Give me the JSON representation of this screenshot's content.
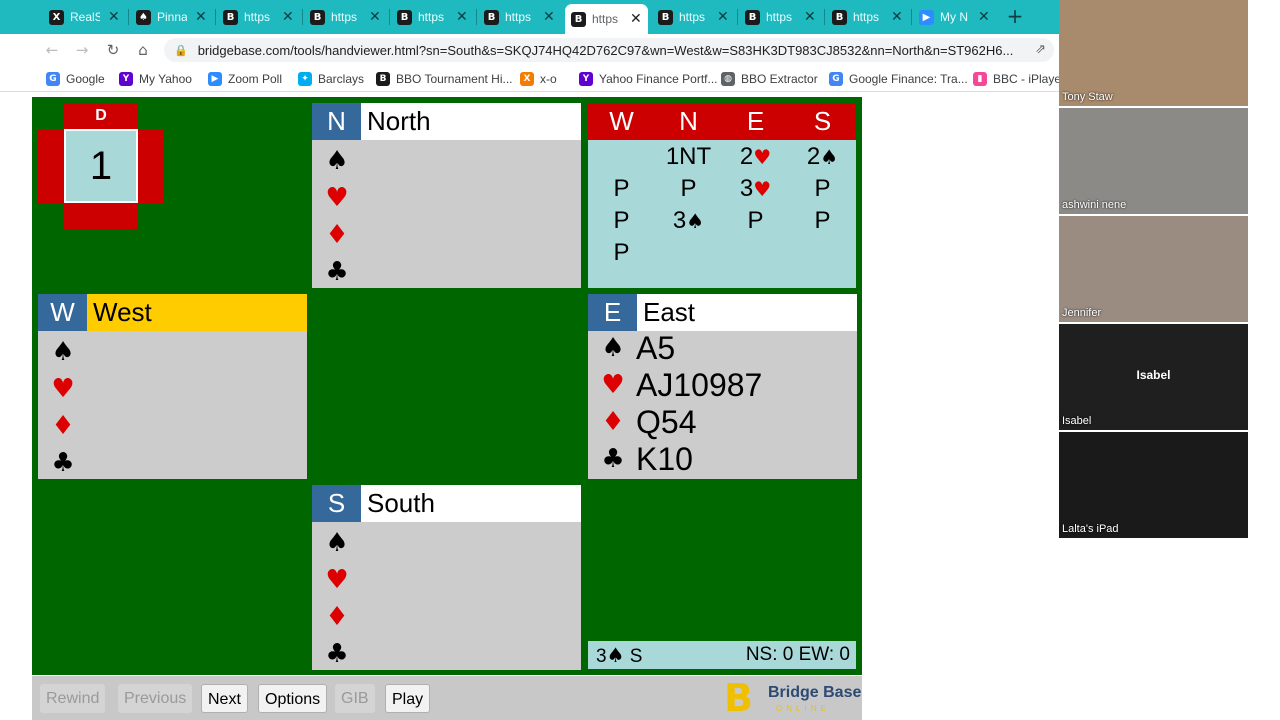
{
  "browser": {
    "tabs": [
      {
        "title": "RealS",
        "icon": "realsmart-icon",
        "color": "#1b1b1b",
        "glyph": "X",
        "active": false
      },
      {
        "title": "Pinna",
        "icon": "pinnacle-icon",
        "color": "#1b1b1b",
        "glyph": "♠",
        "active": false
      },
      {
        "title": "https",
        "icon": "bbo-icon",
        "color": "#1b1b1b",
        "glyph": "B",
        "active": false
      },
      {
        "title": "https",
        "icon": "bbo-icon",
        "color": "#1b1b1b",
        "glyph": "B",
        "active": false
      },
      {
        "title": "https",
        "icon": "bbo-icon",
        "color": "#1b1b1b",
        "glyph": "B",
        "active": false
      },
      {
        "title": "https",
        "icon": "bbo-icon",
        "color": "#1b1b1b",
        "glyph": "B",
        "active": false
      },
      {
        "title": "https",
        "icon": "bbo-icon",
        "color": "#1b1b1b",
        "glyph": "B",
        "active": true
      },
      {
        "title": "https",
        "icon": "bbo-icon",
        "color": "#1b1b1b",
        "glyph": "B",
        "active": false
      },
      {
        "title": "https",
        "icon": "bbo-icon",
        "color": "#1b1b1b",
        "glyph": "B",
        "active": false
      },
      {
        "title": "https",
        "icon": "bbo-icon",
        "color": "#1b1b1b",
        "glyph": "B",
        "active": false
      },
      {
        "title": "My N",
        "icon": "zoom-icon",
        "color": "#2d8cff",
        "glyph": "▶",
        "active": false
      }
    ],
    "url": "bridgebase.com/tools/handviewer.html?sn=South&s=SKQJ74HQ42D762C97&wn=West&w=S83HK3DT983CJ8532&nn=North&n=ST962H6...",
    "bookmarks": [
      {
        "label": "Google",
        "icon": "google-icon",
        "color": "#4285f4",
        "glyph": "G"
      },
      {
        "label": "My Yahoo",
        "icon": "yahoo-icon",
        "color": "#6001d2",
        "glyph": "Y"
      },
      {
        "label": "Zoom Poll",
        "icon": "zoom-icon",
        "color": "#2d8cff",
        "glyph": "▶"
      },
      {
        "label": "Barclays",
        "icon": "barclays-icon",
        "color": "#00aeef",
        "glyph": "✦"
      },
      {
        "label": "BBO Tournament Hi...",
        "icon": "bbo-icon",
        "color": "#1b1b1b",
        "glyph": "B"
      },
      {
        "label": "x-o",
        "icon": "xo-icon",
        "color": "#f57c00",
        "glyph": "X"
      },
      {
        "label": "Yahoo Finance Portf...",
        "icon": "yahoo-icon",
        "color": "#6001d2",
        "glyph": "Y"
      },
      {
        "label": "BBO Extractor",
        "icon": "globe-icon",
        "color": "#5f6368",
        "glyph": "◍"
      },
      {
        "label": "Google Finance: Tra...",
        "icon": "google-icon",
        "color": "#4285f4",
        "glyph": "G"
      },
      {
        "label": "BBC - iPlayer",
        "icon": "iplayer-icon",
        "color": "#f54997",
        "glyph": "▮"
      }
    ]
  },
  "board": {
    "dealer": "D",
    "number": "1"
  },
  "hands": {
    "north": {
      "seat": "N",
      "name": "North",
      "spades": "",
      "hearts": "",
      "diamonds": "",
      "clubs": ""
    },
    "west": {
      "seat": "W",
      "name": "West",
      "spades": "",
      "hearts": "",
      "diamonds": "",
      "clubs": ""
    },
    "east": {
      "seat": "E",
      "name": "East",
      "spades": "A5",
      "hearts": "AJ10987",
      "diamonds": "Q54",
      "clubs": "K10"
    },
    "south": {
      "seat": "S",
      "name": "South",
      "spades": "",
      "hearts": "",
      "diamonds": "",
      "clubs": ""
    }
  },
  "suits": {
    "spade": "♠",
    "heart": "♥",
    "diamond": "♦",
    "club": "♣"
  },
  "auction": {
    "headers": [
      "W",
      "N",
      "E",
      "S"
    ],
    "rows": [
      [
        "",
        "1NT",
        "2♥",
        "2♠"
      ],
      [
        "P",
        "P",
        "3♥",
        "P"
      ],
      [
        "P",
        "3♠",
        "P",
        "P"
      ],
      [
        "P",
        "",
        "",
        ""
      ]
    ]
  },
  "contract": {
    "text": "3♠ S",
    "score": "NS: 0 EW: 0"
  },
  "controls": {
    "rewind": "Rewind",
    "previous": "Previous",
    "next": "Next",
    "options": "Options",
    "gib": "GIB",
    "play": "Play"
  },
  "logo": {
    "text": "Bridge Base",
    "sub": "ONLINE"
  },
  "participants": [
    {
      "name": "Tony Staw",
      "bg": "#a88a6c"
    },
    {
      "name": "ashwini nene",
      "bg": "#8c8a86"
    },
    {
      "name": "Jennifer",
      "bg": "#9a8c80"
    },
    {
      "name": "Isabel",
      "bg": "#1f1f1f",
      "center": "Isabel"
    },
    {
      "name": "Lalta's iPad",
      "bg": "#1a1a1a"
    }
  ],
  "colors": {
    "table_green": "#006600",
    "seat_blue": "#36699b",
    "vul_red": "#cc0000",
    "auction_bg": "#a8d8d8",
    "tab_bar": "#1fb9c0",
    "west_header": "#ffcc00"
  }
}
